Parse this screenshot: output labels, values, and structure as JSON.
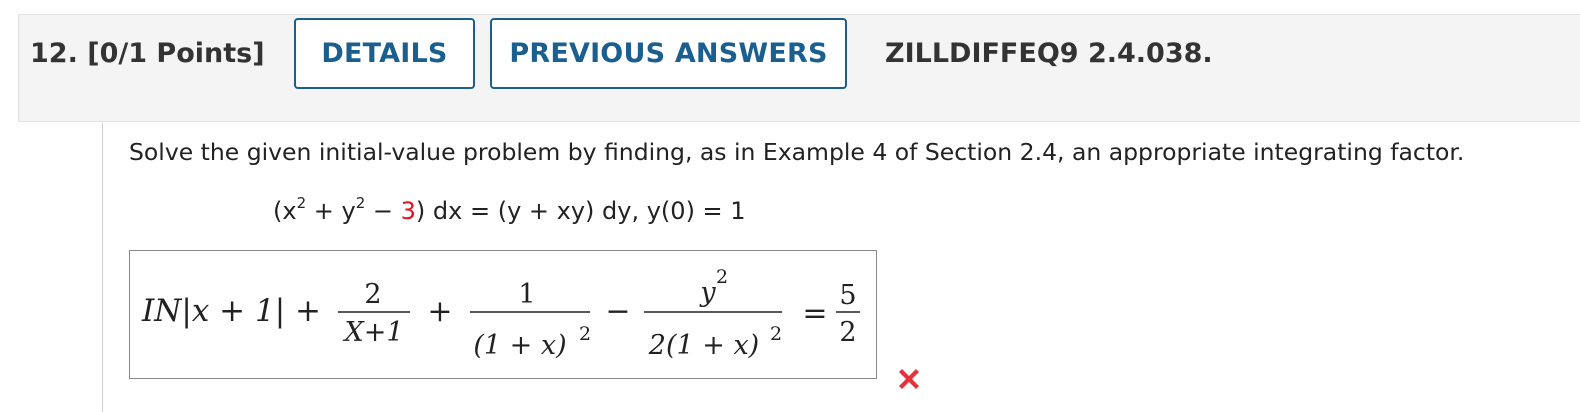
{
  "question": {
    "number": "12.",
    "points": "[0/1 Points]",
    "code": "ZILLDIFFEQ9 2.4.038."
  },
  "buttons": {
    "details": "DETAILS",
    "previous_answers": "PREVIOUS ANSWERS"
  },
  "problem": {
    "prompt": "Solve the given initial-value problem by finding, as in Example 4 of Section 2.4, an appropriate integrating factor.",
    "equation": {
      "open_x": "(x",
      "exp1": "2",
      "plus_y": " + y",
      "exp2": "2",
      "minus": " − ",
      "const": "3",
      "rest": ") dx = (y + xy) dy,    y(0) = 1"
    }
  },
  "answer": {
    "ln_part": "IN|x + 1| +",
    "frac1_num": "2",
    "frac1_den": "X+1",
    "plus": "+",
    "frac2_num": "1",
    "frac2_den": "(1 + x)",
    "frac2_exp": "2",
    "minus": "−",
    "frac3_num": "y",
    "frac3_num_exp": "2",
    "frac3_den": "2(1 + x)",
    "frac3_exp": "2",
    "equals": "=",
    "frac4_num": "5",
    "frac4_den": "2",
    "status": "incorrect",
    "status_icon": "x-mark-icon",
    "status_color": "#e8323a"
  }
}
